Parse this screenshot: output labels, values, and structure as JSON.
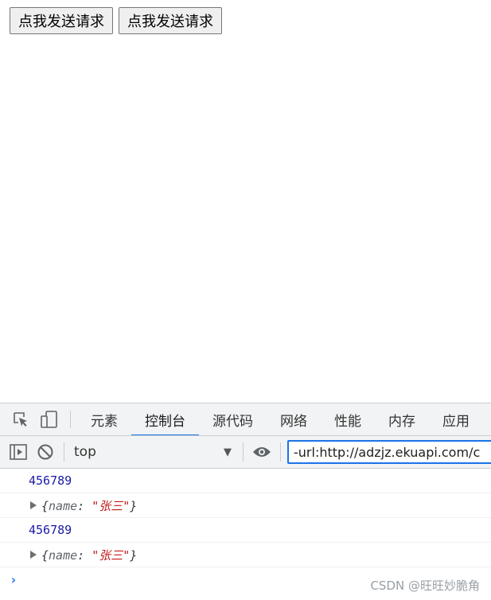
{
  "page": {
    "buttons": [
      "点我发送请求",
      "点我发送请求"
    ]
  },
  "devtools": {
    "tabs": [
      "元素",
      "控制台",
      "源代码",
      "网络",
      "性能",
      "内存",
      "应用"
    ],
    "active_tab_index": 1,
    "context": "top",
    "filter_value": "-url:http://adzjz.ekuapi.com/c",
    "logs": [
      {
        "type": "number",
        "text": "456789"
      },
      {
        "type": "object",
        "prefix": "{",
        "key": "name",
        "colon": ": ",
        "value": "\"张三\"",
        "suffix": "}"
      },
      {
        "type": "number",
        "text": "456789"
      },
      {
        "type": "object",
        "prefix": "{",
        "key": "name",
        "colon": ": ",
        "value": "\"张三\"",
        "suffix": "}"
      }
    ],
    "prompt": "›"
  },
  "watermark": "CSDN @旺旺妙脆角",
  "colors": {
    "accent": "#1a73e8",
    "number": "#1a1aa6",
    "string": "#c41a16"
  }
}
